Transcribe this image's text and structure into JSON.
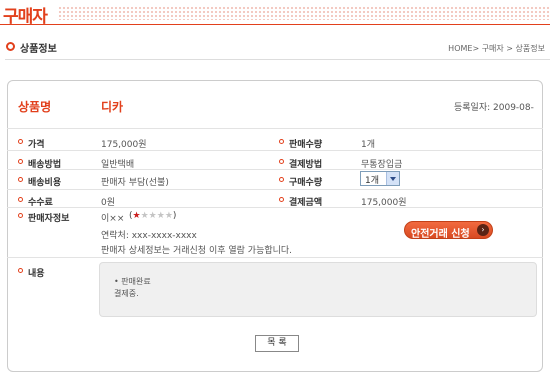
{
  "header": {
    "title": "구매자"
  },
  "section": {
    "title": "상품정보",
    "breadcrumb": "HOME> 구매자 > 상품정보"
  },
  "product": {
    "label": "상품명",
    "name": "디카",
    "reg_date": "등록일자: 2009-08-"
  },
  "fields": {
    "price": {
      "label": "가격",
      "value": "175,000원"
    },
    "sale_qty": {
      "label": "판매수량",
      "value": "1개"
    },
    "delivery": {
      "label": "배송방법",
      "value": "일반택배"
    },
    "payment": {
      "label": "결제방법",
      "value": "무통장입금"
    },
    "delivery_cost": {
      "label": "배송비용",
      "value": "판매자 부담(선불)"
    },
    "buy_qty": {
      "label": "구매수량",
      "selected": "1개"
    },
    "fee": {
      "label": "수수료",
      "value": "0원"
    },
    "pay_amount": {
      "label": "결제금액",
      "value": "175,000원"
    },
    "seller": {
      "label": "판매자정보",
      "name": "이××",
      "rating": 1,
      "rating_max": 5,
      "contact": "연락처: xxx-xxxx-xxxx",
      "note": "판매자 상세정보는 거래신청 이후 열람 가능합니다."
    },
    "content": {
      "label": "내용",
      "line1": "• 판매완료",
      "line2": "결제중."
    }
  },
  "buttons": {
    "safe_trade": "안전거래 신청",
    "list": "목 록"
  },
  "colors": {
    "accent": "#e2401c",
    "button": "#e05a2f"
  },
  "icons": {
    "safe_arrow": "chevron-right-icon",
    "star": "star-icon"
  }
}
